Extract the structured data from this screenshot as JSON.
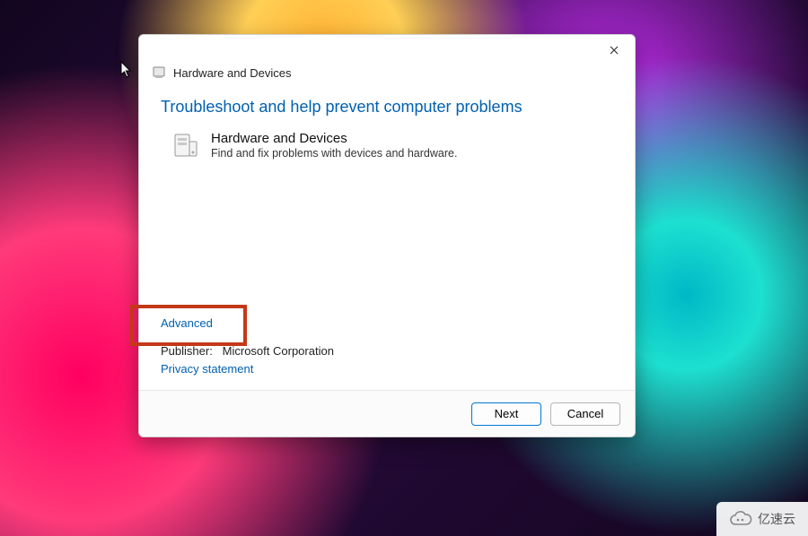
{
  "window": {
    "title": "Hardware and Devices"
  },
  "content": {
    "heading": "Troubleshoot and help prevent computer problems",
    "item": {
      "title": "Hardware and Devices",
      "description": "Find and fix problems with devices and hardware."
    }
  },
  "links": {
    "advanced": "Advanced",
    "privacy": "Privacy statement"
  },
  "meta": {
    "publisher_label": "Publisher:",
    "publisher_value": "Microsoft Corporation"
  },
  "buttons": {
    "next": "Next",
    "cancel": "Cancel"
  },
  "watermark": {
    "text": "亿速云"
  },
  "highlight": {
    "target": "advanced-link",
    "color": "#c43818"
  }
}
